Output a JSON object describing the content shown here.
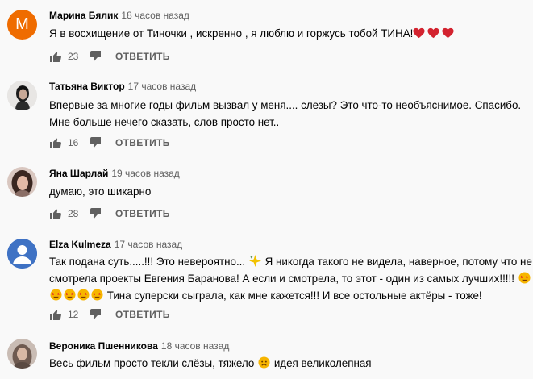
{
  "comments": [
    {
      "author": "Марина Бялик",
      "time": "18 часов назад",
      "avatar_letter": "М",
      "avatar_color": "#ef6c00",
      "lines": [
        "Я в восхищение от Тиночки , искренно , я люблю и горжусь тобой ТИНА!"
      ],
      "likes": "23"
    },
    {
      "author": "Татьяна Виктор",
      "time": "17 часов назад",
      "lines": [
        "Впервые за многие годы фильм вызвал у меня.... слезы? Это что-то необъяснимое. Спасибо.",
        "Мне больше нечего сказать, слов просто нет.."
      ],
      "likes": "16"
    },
    {
      "author": "Яна Шарлай",
      "time": "19 часов назад",
      "lines": [
        "думаю, это шикарно"
      ],
      "likes": "28"
    },
    {
      "author": "Elza Kulmeza",
      "time": "17 часов назад",
      "avatar_color": "#3f72c4",
      "lines": [
        "Так подана суть.....!!! Это невероятно...",
        "Я никогда такого не видела, наверное, потому что не",
        "смотрела проекты Евгения Баранова! А если и смотрела, то этот - один из самых лучших!!!!!",
        "Тина суперски сыграла, как мне кажется!!! И все остольные актёры - тоже!"
      ],
      "likes": "12"
    },
    {
      "author": "Вероника Пшенникова",
      "time": "18 часов назад",
      "lines": [
        "Весь фильм просто текли слёзы, тяжело",
        "идея великолепная"
      ]
    }
  ],
  "reply_label": "ОТВЕТИТЬ",
  "colors": {
    "text": "#030303",
    "meta": "#606060",
    "heart": "#d3232f",
    "emoji": "#f7b500"
  }
}
